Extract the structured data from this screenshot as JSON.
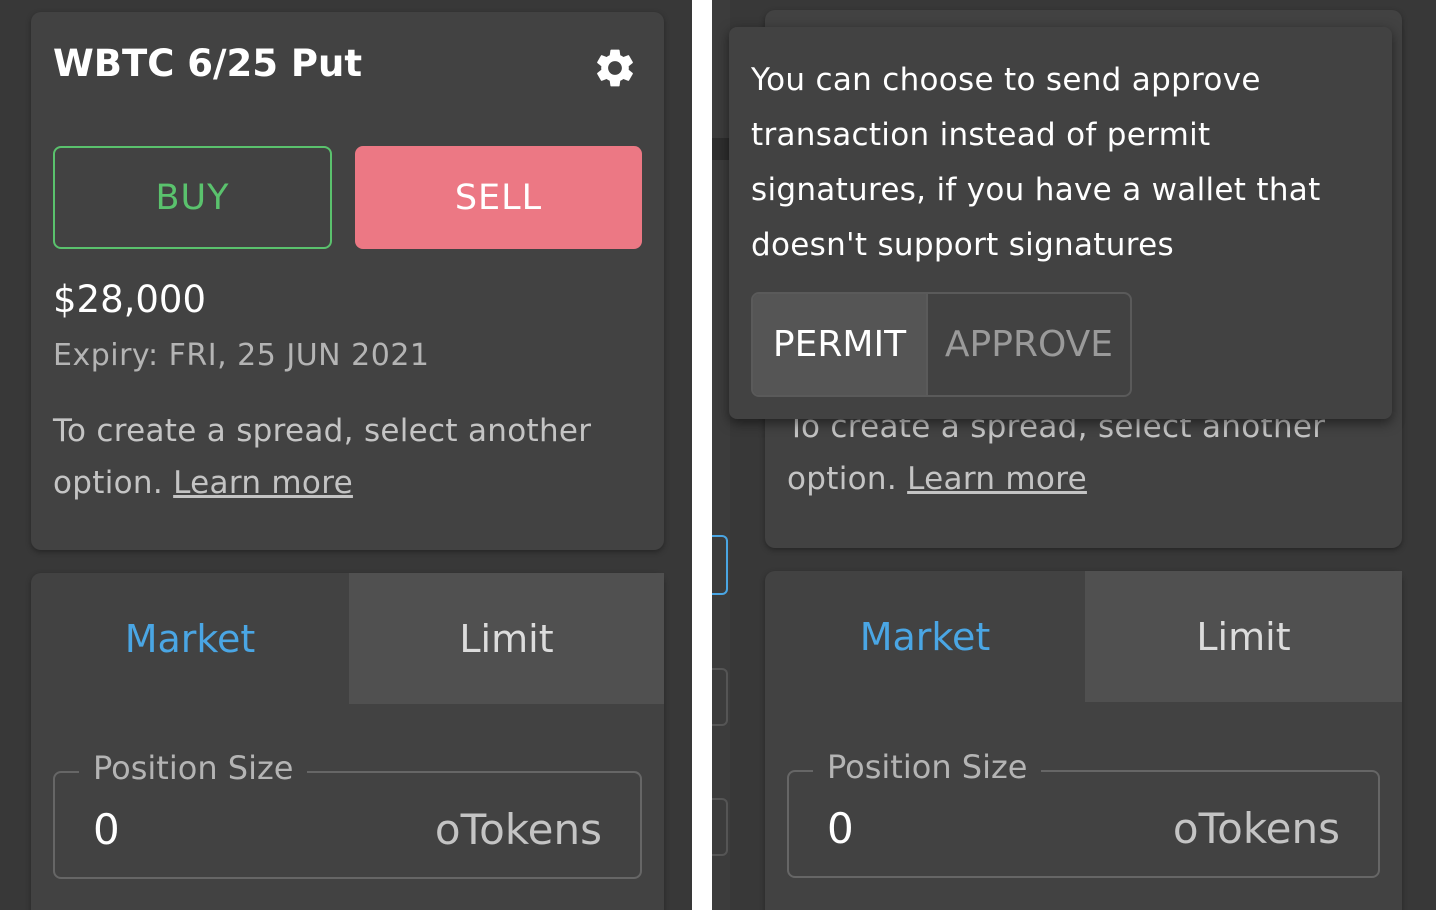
{
  "option": {
    "title": "WBTC 6/25 Put",
    "buy_label": "BUY",
    "sell_label": "SELL",
    "strike_price": "$28,000",
    "expiry": "Expiry: FRI, 25 JUN 2021",
    "spread_text": "To create a spread, select another option.",
    "learn_more": "Learn more"
  },
  "order": {
    "tabs": [
      {
        "label": "Market",
        "active": true
      },
      {
        "label": "Limit",
        "active": false
      }
    ],
    "position_size": {
      "label": "Position Size",
      "value": "0",
      "unit": "oTokens"
    }
  },
  "settings_popup": {
    "text": "You can choose to send approve transaction instead of permit signatures, if you have a wallet that doesn't support signatures",
    "options": [
      "PERMIT",
      "APPROVE"
    ],
    "selected": "PERMIT"
  },
  "colors": {
    "buy": "#5ac26d",
    "sell": "#ec7884",
    "market_tab": "#4aa6e4",
    "panel_bg": "#383838",
    "card_bg": "#424242"
  },
  "icons": {
    "settings": "gear-icon"
  }
}
